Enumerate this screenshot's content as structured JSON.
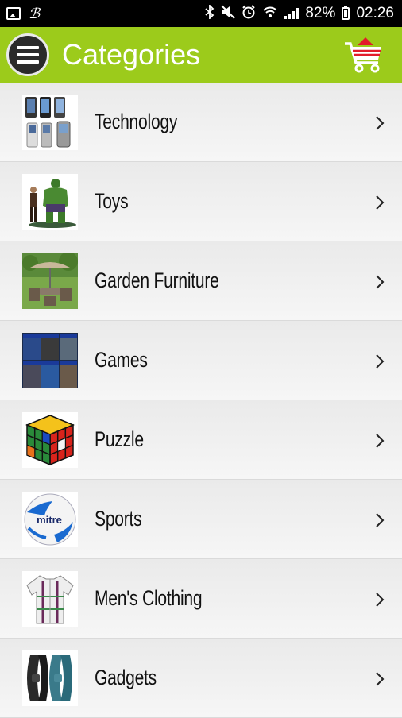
{
  "status_bar": {
    "battery": "82%",
    "time": "02:26"
  },
  "app_bar": {
    "title": "Categories"
  },
  "categories": [
    {
      "label": "Technology",
      "icon": "phones-thumbnail"
    },
    {
      "label": "Toys",
      "icon": "action-figures-thumbnail"
    },
    {
      "label": "Garden Furniture",
      "icon": "garden-set-thumbnail"
    },
    {
      "label": "Games",
      "icon": "game-covers-thumbnail"
    },
    {
      "label": "Puzzle",
      "icon": "rubiks-cube-thumbnail"
    },
    {
      "label": "Sports",
      "icon": "soccer-ball-thumbnail",
      "ball_text": "mitre"
    },
    {
      "label": "Men's Clothing",
      "icon": "shirt-thumbnail"
    },
    {
      "label": "Gadgets",
      "icon": "fitness-bands-thumbnail"
    }
  ],
  "colors": {
    "app_bar": "#9ccb1b",
    "status_bar": "#000000",
    "cart_red": "#e21b2b"
  }
}
